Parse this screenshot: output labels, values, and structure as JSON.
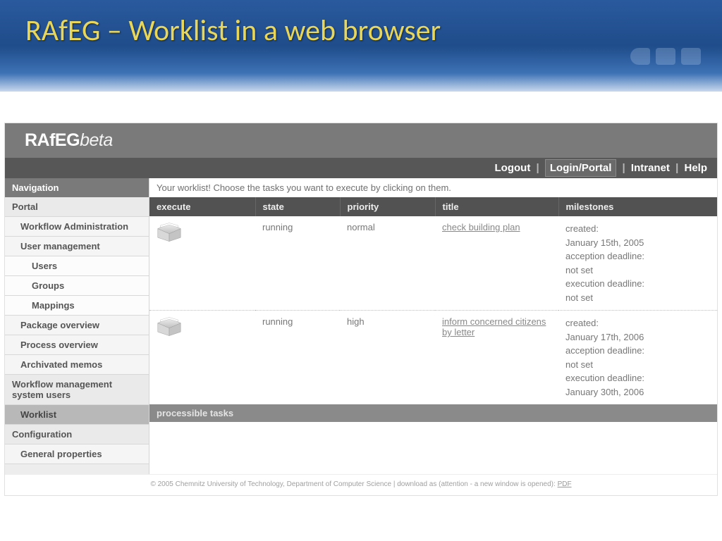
{
  "slide": {
    "title": "RAfEG – Worklist in a web browser"
  },
  "brand": {
    "name": "RAfEG",
    "suffix": "beta"
  },
  "topnav": {
    "logout": "Logout",
    "login": "Login/Portal",
    "intranet": "Intranet",
    "help": "Help"
  },
  "sidebar": {
    "header": "Navigation",
    "items": [
      {
        "label": "Portal",
        "indent": 0
      },
      {
        "label": "Workflow Administration",
        "indent": 1
      },
      {
        "label": "User management",
        "indent": 1
      },
      {
        "label": "Users",
        "indent": 2
      },
      {
        "label": "Groups",
        "indent": 2
      },
      {
        "label": "Mappings",
        "indent": 2
      },
      {
        "label": "Package overview",
        "indent": 1
      },
      {
        "label": "Process overview",
        "indent": 1
      },
      {
        "label": "Archivated memos",
        "indent": 1
      },
      {
        "label": "Workflow management system users",
        "indent": 0
      },
      {
        "label": "Worklist",
        "indent": 1,
        "active": true
      },
      {
        "label": "Configuration",
        "indent": 0
      },
      {
        "label": "General properties",
        "indent": 1
      }
    ]
  },
  "content": {
    "instruction": "Your worklist! Choose the tasks you want to execute by clicking on them.",
    "columns": {
      "execute": "execute",
      "state": "state",
      "priority": "priority",
      "title": "title",
      "milestones": "milestones"
    },
    "tasks": [
      {
        "state": "running",
        "priority": "normal",
        "title": "check building plan",
        "milestones": {
          "created_label": "created:",
          "created": "January 15th, 2005",
          "acc_label": "acception deadline:",
          "acc": "not set",
          "exec_label": "execution deadline:",
          "exec": "not set"
        }
      },
      {
        "state": "running",
        "priority": "high",
        "title": "inform concerned citizens by letter",
        "milestones": {
          "created_label": "created:",
          "created": "January 17th, 2006",
          "acc_label": "acception deadline:",
          "acc": "not set",
          "exec_label": "execution deadline:",
          "exec": "January 30th, 2006"
        }
      }
    ],
    "section_bar": "processible tasks"
  },
  "footer": {
    "text": "© 2005 Chemnitz University of Technology, Department of Computer Science | download as (attention - a new window is opened): ",
    "link": "PDF"
  }
}
